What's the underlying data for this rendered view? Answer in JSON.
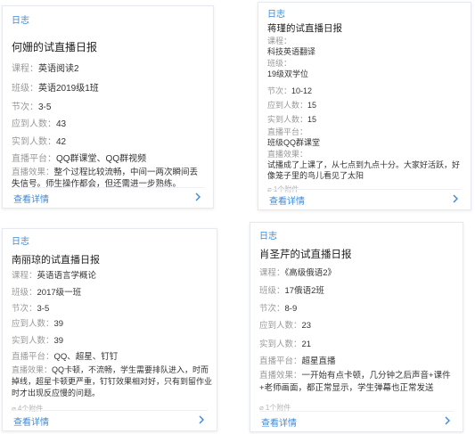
{
  "cards": [
    {
      "tag": "日志",
      "title": "何姗的试直播日报",
      "fields": [
        {
          "label": "课程：",
          "value": "英语阅读2"
        },
        {
          "label": "班级：",
          "value": "英语2019级1班"
        },
        {
          "label": "节次：",
          "value": "3-5"
        },
        {
          "label": "应到人数：",
          "value": "43"
        },
        {
          "label": "实到人数：",
          "value": "42"
        },
        {
          "label": "直播平台：",
          "value": "QQ群课堂、QQ群视频"
        },
        {
          "label": "直播效果：",
          "value": "整个过程比较流畅，中间一两次瞬间丢失信号。师生操作都会，但还需进一步熟练。"
        }
      ],
      "attachment": "",
      "details_label": "查看详情"
    },
    {
      "tag": "日志",
      "title": "蒋瑾的试直播日报",
      "fields": [
        {
          "label": "课程：",
          "value": "科技英语翻译"
        },
        {
          "label": "班级：",
          "value": "19级双学位"
        },
        {
          "label": "节次：",
          "value": "10-12"
        },
        {
          "label": "应到人数：",
          "value": "15"
        },
        {
          "label": "实到人数：",
          "value": "15"
        },
        {
          "label": "直播平台：",
          "value": "班级QQ群课堂"
        },
        {
          "label": "直播效果：",
          "value": "试播成了上课了，从七点到九点十分。大家好活跃，好像笼子里的鸟儿看见了太阳"
        }
      ],
      "attachment": "1个附件",
      "details_label": "查看详情"
    },
    {
      "tag": "日志",
      "title": "南丽琼的试直播日报",
      "fields": [
        {
          "label": "课程：",
          "value": "英语语言学概论"
        },
        {
          "label": "班级：",
          "value": "2017级一班"
        },
        {
          "label": "节次：",
          "value": "3-5"
        },
        {
          "label": "应到人数：",
          "value": "39"
        },
        {
          "label": "实到人数：",
          "value": "39"
        },
        {
          "label": "直播平台：",
          "value": "QQ、超星、钉钉"
        },
        {
          "label": "直播效果：",
          "value": "QQ卡顿，不流畅，学生需要排队进入，时而掉线，超星卡顿更严重，钉钉效果相对好，只有到留作业时才出现反应慢的问题。"
        }
      ],
      "attachment": "4个附件",
      "details_label": "查看详情"
    },
    {
      "tag": "日志",
      "title": "肖圣芹的试直播日报",
      "fields": [
        {
          "label": "课程：",
          "value": "《高级俄语2》"
        },
        {
          "label": "班级：",
          "value": "17俄语2班"
        },
        {
          "label": "节次：",
          "value": "8-9"
        },
        {
          "label": "应到人数：",
          "value": "23"
        },
        {
          "label": "实到人数：",
          "value": "21"
        },
        {
          "label": "直播平台：",
          "value": "超星直播"
        },
        {
          "label": "直播效果：",
          "value": "一开始有点卡顿，几分钟之后声音+课件+老师画面，都正常显示，学生弹幕也正常发送"
        }
      ],
      "attachment": "1个附件",
      "details_label": "查看详情"
    }
  ]
}
